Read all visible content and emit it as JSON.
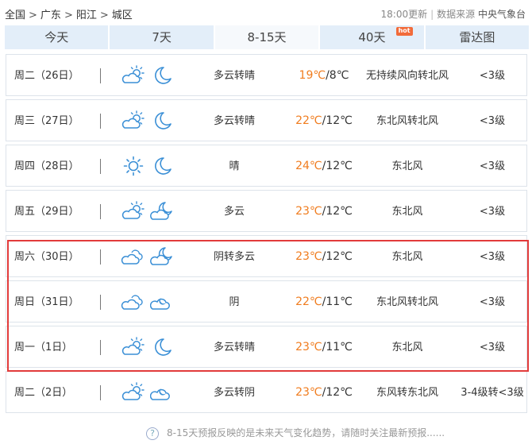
{
  "breadcrumb": {
    "items": [
      "全国",
      "广东",
      "阳江",
      "城区"
    ],
    "separator": ">"
  },
  "update": {
    "time": "18:00更新",
    "source_label": "数据来源",
    "source": "中央气象台"
  },
  "tabs": [
    {
      "label": "今天",
      "active": false
    },
    {
      "label": "7天",
      "active": false
    },
    {
      "label": "8-15天",
      "active": true
    },
    {
      "label": "40天",
      "active": false,
      "badge": "hot"
    },
    {
      "label": "雷达图",
      "active": false
    }
  ],
  "forecast": [
    {
      "day": "周二（26日）",
      "icon_day": "partly-cloudy-sun-icon",
      "icon_night": "moon-icon",
      "desc": "多云转晴",
      "high": "19℃",
      "low": "/8℃",
      "wind": "无持续风向转北风",
      "level": "<3级"
    },
    {
      "day": "周三（27日）",
      "icon_day": "partly-cloudy-sun-icon",
      "icon_night": "moon-icon",
      "desc": "多云转晴",
      "high": "22℃",
      "low": "/12℃",
      "wind": "东北风转北风",
      "level": "<3级"
    },
    {
      "day": "周四（28日）",
      "icon_day": "sun-icon",
      "icon_night": "moon-icon",
      "desc": "晴",
      "high": "24℃",
      "low": "/12℃",
      "wind": "东北风",
      "level": "<3级"
    },
    {
      "day": "周五（29日）",
      "icon_day": "partly-cloudy-sun-icon",
      "icon_night": "cloudy-moon-icon",
      "desc": "多云",
      "high": "23℃",
      "low": "/12℃",
      "wind": "东北风",
      "level": "<3级"
    },
    {
      "day": "周六（30日）",
      "icon_day": "overcast-icon",
      "icon_night": "cloudy-moon-icon",
      "desc": "阴转多云",
      "high": "23℃",
      "low": "/12℃",
      "wind": "东北风",
      "level": "<3级"
    },
    {
      "day": "周日（31日）",
      "icon_day": "overcast-icon",
      "icon_night": "cloud-night-icon",
      "desc": "阴",
      "high": "22℃",
      "low": "/11℃",
      "wind": "东北风转北风",
      "level": "<3级"
    },
    {
      "day": "周一（1日）",
      "icon_day": "partly-cloudy-sun-icon",
      "icon_night": "moon-icon",
      "desc": "多云转晴",
      "high": "23℃",
      "low": "/11℃",
      "wind": "东北风",
      "level": "<3级"
    },
    {
      "day": "周二（2日）",
      "icon_day": "partly-cloudy-sun-icon",
      "icon_night": "cloud-night-icon",
      "desc": "多云转阴",
      "high": "23℃",
      "low": "/12℃",
      "wind": "东风转东北风",
      "level": "3-4级转<3级"
    }
  ],
  "footer": {
    "note": "8-15天预报反映的是未来天气变化趋势，请随时关注最新预报......"
  },
  "colors": {
    "tab_bg": "#e3eef9",
    "tab_active_bg": "#f6f9fc",
    "temp_high": "#f07c1e",
    "highlight_border": "#e23b3b",
    "icon_stroke": "#3a8fd6"
  }
}
